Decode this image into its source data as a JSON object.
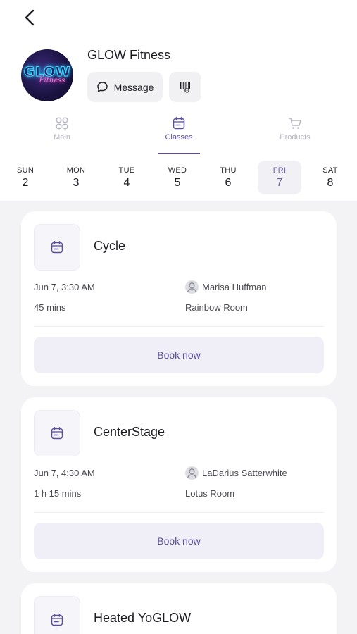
{
  "studio": {
    "name": "GLOW Fitness",
    "logo_text": "GLOW",
    "logo_sub": "Fitness"
  },
  "header": {
    "message_label": "Message"
  },
  "tabs": [
    {
      "label": "Main",
      "icon": "grid-icon"
    },
    {
      "label": "Classes",
      "icon": "calendar-icon"
    },
    {
      "label": "Products",
      "icon": "cart-icon"
    }
  ],
  "days": [
    {
      "name": "SUN",
      "date": "2"
    },
    {
      "name": "MON",
      "date": "3"
    },
    {
      "name": "TUE",
      "date": "4"
    },
    {
      "name": "WED",
      "date": "5"
    },
    {
      "name": "THU",
      "date": "6"
    },
    {
      "name": "FRI",
      "date": "7"
    },
    {
      "name": "SAT",
      "date": "8"
    }
  ],
  "classes": [
    {
      "title": "Cycle",
      "datetime": "Jun 7, 3:30 AM",
      "duration": "45 mins",
      "instructor": "Marisa Huffman",
      "room": "Rainbow Room",
      "book_label": "Book now"
    },
    {
      "title": "CenterStage",
      "datetime": "Jun 7, 4:30 AM",
      "duration": "1 h 15 mins",
      "instructor": "LaDarius Satterwhite",
      "room": "Lotus Room",
      "book_label": "Book now"
    },
    {
      "title": "Heated YoGLOW"
    }
  ],
  "colors": {
    "accent": "#5b4f9a",
    "background": "#f3f3f5",
    "active_day_bg": "#f1f1f5"
  }
}
